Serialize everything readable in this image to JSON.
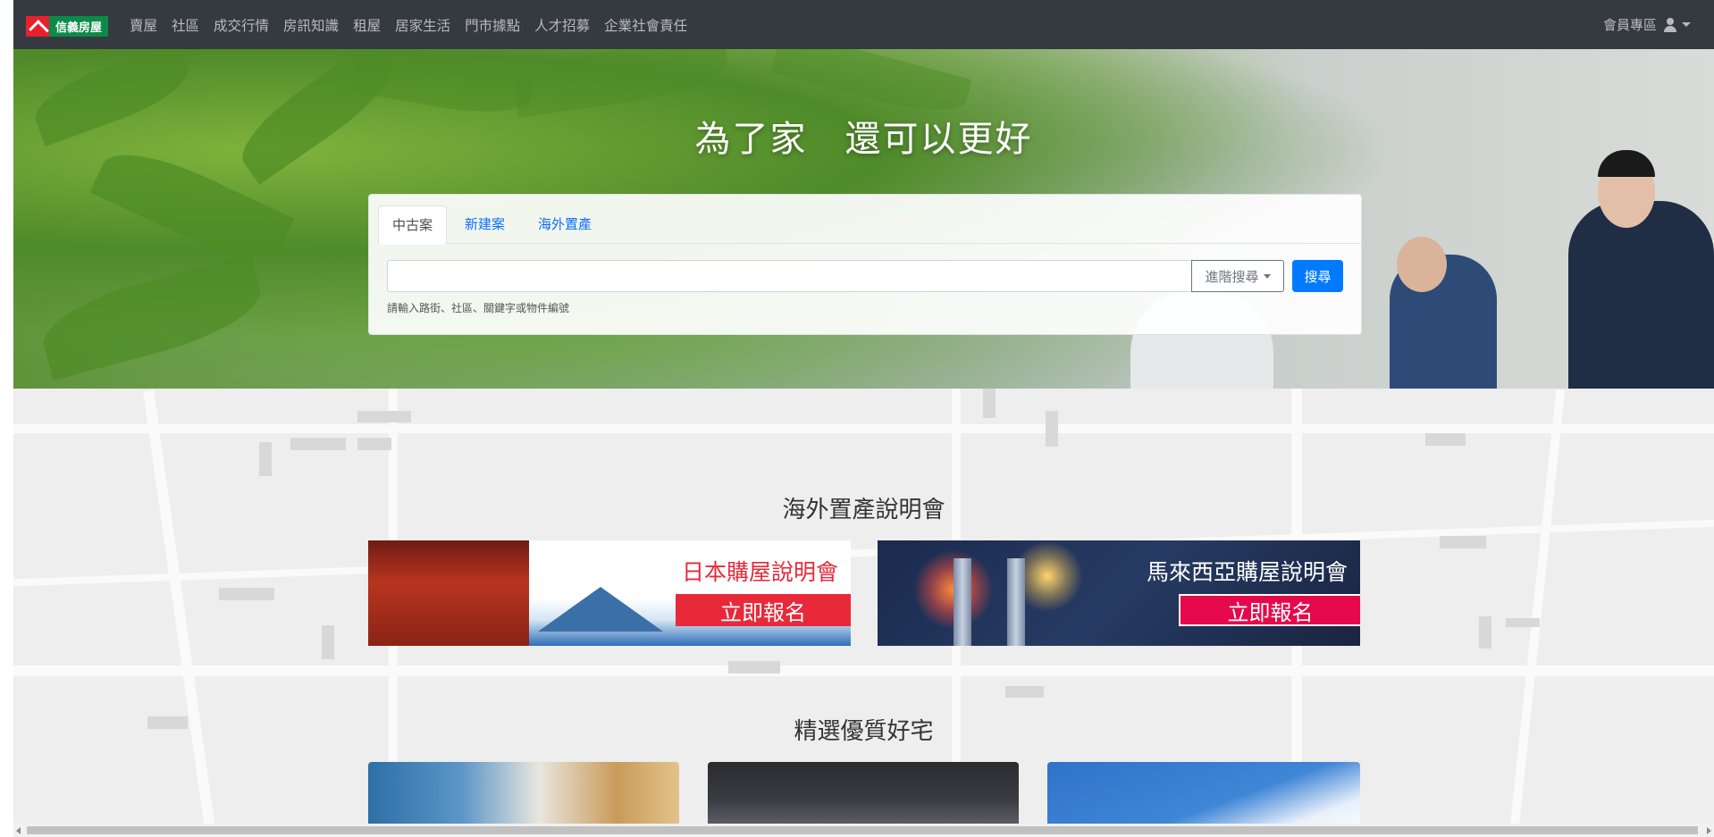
{
  "brand": {
    "logo_text": "信義房屋"
  },
  "nav": {
    "items": [
      "賣屋",
      "社區",
      "成交行情",
      "房訊知識",
      "租屋",
      "居家生活",
      "門市據點",
      "人才招募",
      "企業社會責任"
    ],
    "member_label": "會員專區"
  },
  "hero": {
    "title": "為了家　還可以更好"
  },
  "search": {
    "tabs": [
      "中古案",
      "新建案",
      "海外置產"
    ],
    "input_value": "",
    "advanced_label": "進階搜尋",
    "submit_label": "搜尋",
    "hint": "請輸入路街、社區、關鍵字或物件編號"
  },
  "seminars": {
    "title": "海外置產說明會",
    "banners": [
      {
        "title": "日本購屋說明會",
        "cta": "立即報名"
      },
      {
        "title": "馬來西亞購屋說明會",
        "cta": "立即報名"
      }
    ]
  },
  "featured": {
    "title": "精選優質好宅"
  },
  "colors": {
    "navbar": "#343a40",
    "primary": "#007bff",
    "japan_red": "#e8293a",
    "malaysia_red": "#e5094c"
  }
}
